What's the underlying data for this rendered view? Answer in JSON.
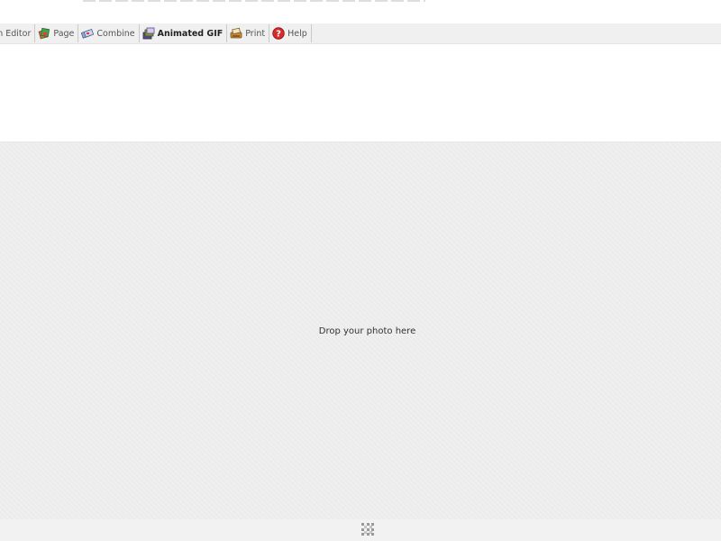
{
  "toolbar": {
    "tabs": [
      {
        "label": "ch Editor",
        "icon": "batch-editor-icon",
        "active": false
      },
      {
        "label": "Page",
        "icon": "page-icon",
        "active": false
      },
      {
        "label": "Combine",
        "icon": "combine-icon",
        "active": false
      },
      {
        "label": "Animated GIF",
        "icon": "animated-gif-icon",
        "active": true
      },
      {
        "label": "Print",
        "icon": "print-icon",
        "active": false
      },
      {
        "label": "Help",
        "icon": "help-icon",
        "active": false
      }
    ]
  },
  "drop_area": {
    "prompt": "Drop your photo here"
  },
  "bottom_bar": {
    "handle_icon": "resize-handle-icon"
  },
  "colors": {
    "toolbar_bg": "#f0f0f0",
    "drop_area_bg": "#ececec",
    "help_red": "#d62b2b"
  }
}
